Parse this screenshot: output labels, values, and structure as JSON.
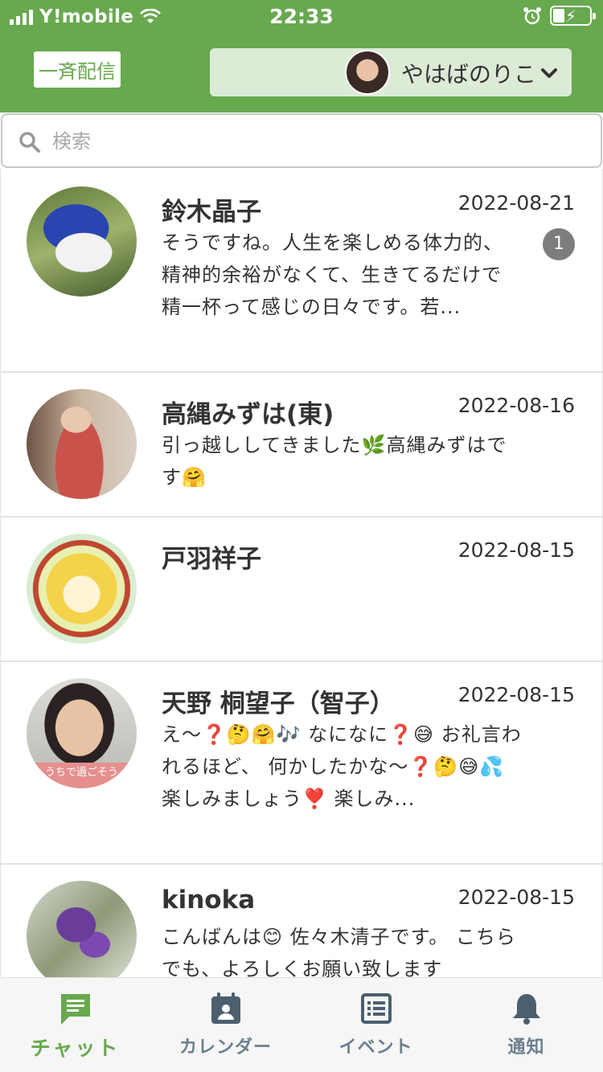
{
  "status_bar": {
    "carrier": "Y!mobile",
    "time": "22:33"
  },
  "header": {
    "broadcast_label": "一斉配信",
    "current_user": "やはばのりこ"
  },
  "search": {
    "placeholder": "検索"
  },
  "chats": [
    {
      "name": "鈴木晶子",
      "date": "2022-08-21",
      "message": "そうですね。人生を楽しめる体力的、精神的余裕がなくて、生きてるだけで精一杯って感じの日々です。若...",
      "unread": "1"
    },
    {
      "name": "高縄みずは(東)",
      "date": "2022-08-16",
      "message": "引っ越ししてきました🌿高縄みずはです🤗"
    },
    {
      "name": "戸羽祥子",
      "date": "2022-08-15",
      "message": ""
    },
    {
      "name": "天野 桐望子（智子）",
      "date": "2022-08-15",
      "message": "え〜❓🤔🤗🎶 なになに❓😅 お礼言われるほど、 何かしたかな〜❓🤔😅💦 楽しみましょう❣️ 楽しみ...",
      "avatar_caption": "うちで過ごそう"
    },
    {
      "name": "kinoka",
      "date": "2022-08-15",
      "message": "こんばんは😊 佐々木清子です。 こちらでも、よろしくお願い致します"
    }
  ],
  "nav": {
    "chat": "チャット",
    "calendar": "カレンダー",
    "event": "イベント",
    "notification": "通知"
  },
  "colors": {
    "brand_green": "#68a84f",
    "badge_gray": "#7d7d7d",
    "nav_inactive": "#6b7f8c"
  }
}
